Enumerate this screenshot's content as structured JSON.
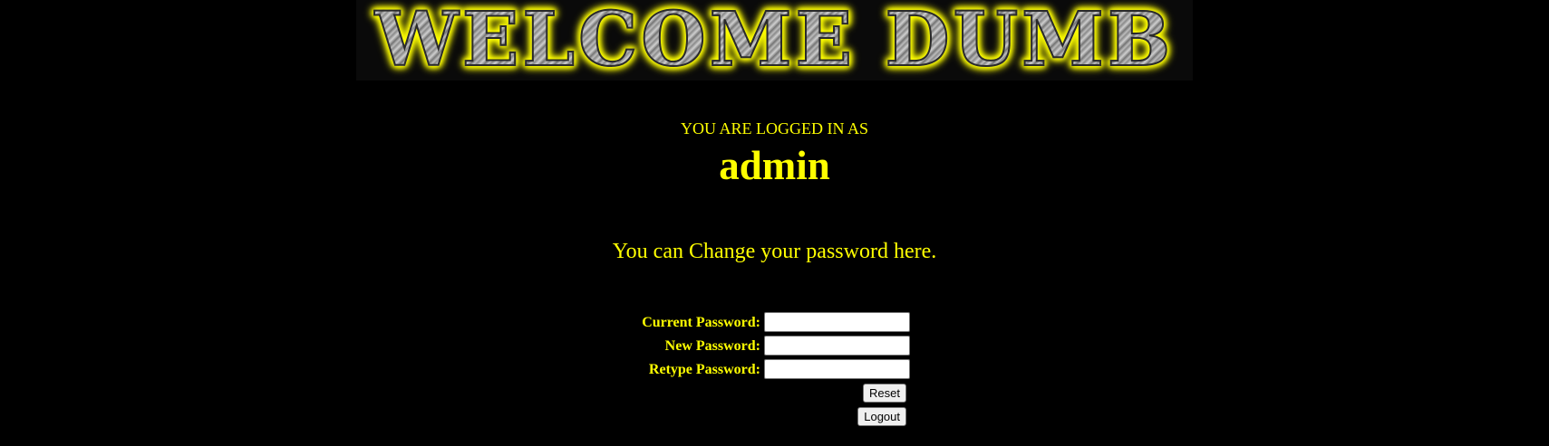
{
  "banner": {
    "text": "WELCOME DUMB"
  },
  "session": {
    "logged_in_label": "YOU ARE LOGGED IN AS",
    "username": "admin"
  },
  "message": "You can Change your password here.",
  "form": {
    "current_password_label": "Current Password:",
    "new_password_label": "New Password:",
    "retype_password_label": "Retype Password:",
    "current_password_value": "",
    "new_password_value": "",
    "retype_password_value": "",
    "reset_button": "Reset",
    "logout_button": "Logout"
  },
  "colors": {
    "background": "#000000",
    "text": "#ffff00",
    "banner_glow": "#ffff00",
    "banner_metal": "#9a9a9a"
  }
}
